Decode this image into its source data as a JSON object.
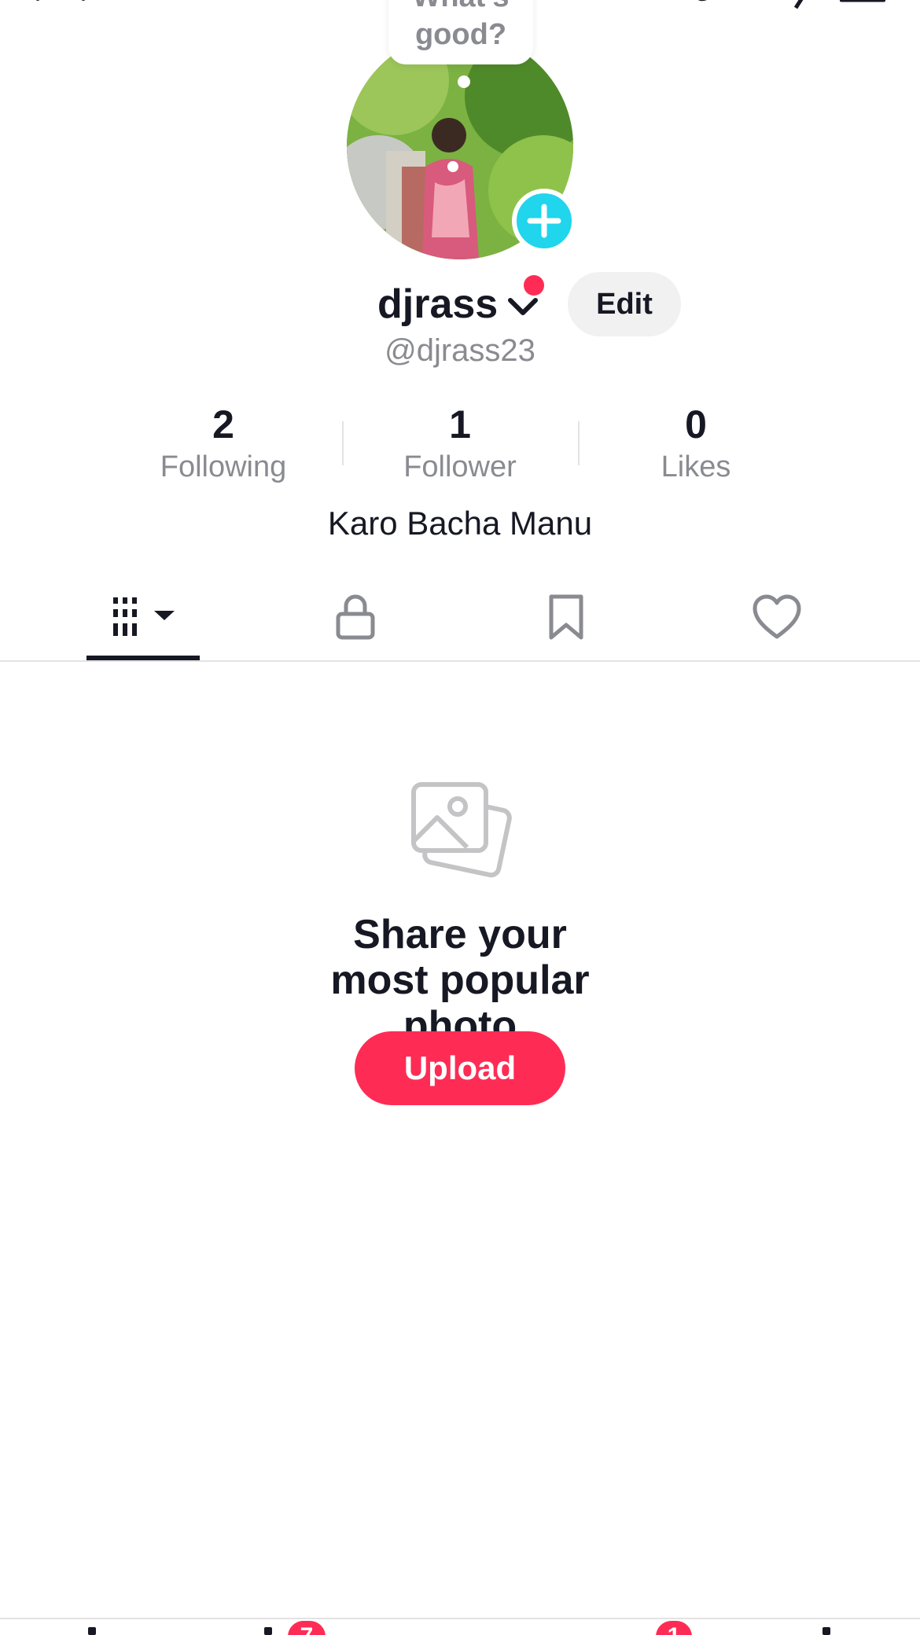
{
  "profile": {
    "bubble_text": "What's good?",
    "username": "djrass",
    "handle": "@djrass23",
    "edit_label": "Edit",
    "bio": "Karo Bacha Manu"
  },
  "stats": [
    {
      "count": "2",
      "label": "Following"
    },
    {
      "count": "1",
      "label": "Follower"
    },
    {
      "count": "0",
      "label": "Likes"
    }
  ],
  "tabs": [
    {
      "icon": "videos-grid-icon",
      "active": true
    },
    {
      "icon": "lock-icon",
      "active": false
    },
    {
      "icon": "bookmark-icon",
      "active": false
    },
    {
      "icon": "heart-icon",
      "active": false
    }
  ],
  "empty_state": {
    "title": "Share your most popular photo",
    "button_label": "Upload",
    "icon": "photos-icon"
  },
  "bottom_nav": {
    "inbox_badge": "7",
    "profile_badge": "1"
  },
  "colors": {
    "accent": "#fe2c55",
    "add_button": "#20d5ec",
    "text": "#161823",
    "muted": "#8a8b91"
  }
}
